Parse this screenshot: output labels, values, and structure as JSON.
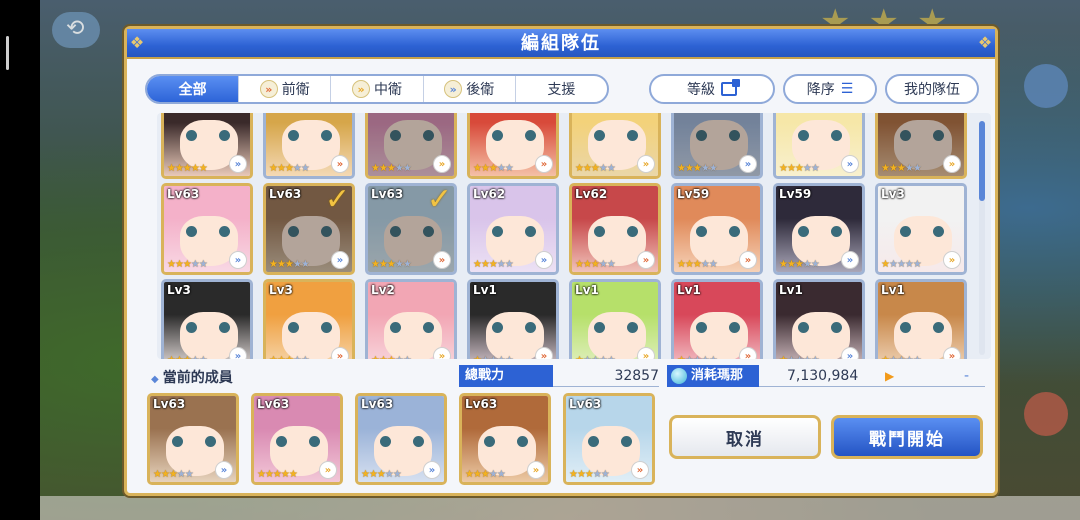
{
  "dialog": {
    "title": "編組隊伍"
  },
  "filter": {
    "tabs": [
      {
        "label": "全部",
        "icon": null,
        "active": true
      },
      {
        "label": "前衛",
        "icon": "front-role-icon",
        "active": false
      },
      {
        "label": "中衛",
        "icon": "mid-role-icon",
        "active": false
      },
      {
        "label": "後衛",
        "icon": "back-role-icon",
        "active": false
      },
      {
        "label": "支援",
        "icon": null,
        "active": false
      }
    ],
    "sort_label": "等級",
    "order_label": "降序",
    "my_team_label": "我的隊伍"
  },
  "roster": [
    {
      "lv": "",
      "stars": 5,
      "max_stars": 5,
      "role": "back",
      "selected": false,
      "hair": "#3a2a2a",
      "bg": "#e9c9b9",
      "rare": true
    },
    {
      "lv": "",
      "stars": 3,
      "max_stars": 5,
      "role": "front",
      "selected": false,
      "hair": "#d6a64a",
      "bg": "#f4d9b5",
      "rare": false
    },
    {
      "lv": "",
      "stars": 3,
      "max_stars": 5,
      "role": "mid",
      "selected": true,
      "hair": "#d98ab2",
      "bg": "#f2c7d7",
      "rare": true
    },
    {
      "lv": "",
      "stars": 3,
      "max_stars": 5,
      "role": "front",
      "selected": false,
      "hair": "#d84a3a",
      "bg": "#f4c0a6",
      "rare": true
    },
    {
      "lv": "",
      "stars": 3,
      "max_stars": 5,
      "role": "mid",
      "selected": false,
      "hair": "#f3d27a",
      "bg": "#ead6a8",
      "rare": true
    },
    {
      "lv": "",
      "stars": 3,
      "max_stars": 5,
      "role": "back",
      "selected": true,
      "hair": "#9bb3d8",
      "bg": "#c9d6ea",
      "rare": false
    },
    {
      "lv": "",
      "stars": 3,
      "max_stars": 5,
      "role": "back",
      "selected": false,
      "hair": "#f6e7a8",
      "bg": "#f8f0cf",
      "rare": false
    },
    {
      "lv": "",
      "stars": 3,
      "max_stars": 5,
      "role": "mid",
      "selected": true,
      "hair": "#b06a3a",
      "bg": "#e9c29a",
      "rare": true
    },
    {
      "lv": "Lv63",
      "stars": 3,
      "max_stars": 5,
      "role": "back",
      "selected": false,
      "hair": "#f4b1c9",
      "bg": "#f8d8e4",
      "rare": true
    },
    {
      "lv": "Lv63",
      "stars": 3,
      "max_stars": 5,
      "role": "back",
      "selected": true,
      "hair": "#9a7250",
      "bg": "#d7c2a8",
      "rare": true
    },
    {
      "lv": "Lv63",
      "stars": 3,
      "max_stars": 5,
      "role": "front",
      "selected": true,
      "hair": "#b7d6ea",
      "bg": "#d9e9f2",
      "rare": false
    },
    {
      "lv": "Lv62",
      "stars": 3,
      "max_stars": 5,
      "role": "back",
      "selected": false,
      "hair": "#d9c4ea",
      "bg": "#ece1f4",
      "rare": false
    },
    {
      "lv": "Lv62",
      "stars": 3,
      "max_stars": 5,
      "role": "front",
      "selected": false,
      "hair": "#c7484a",
      "bg": "#f0c2b9",
      "rare": true
    },
    {
      "lv": "Lv59",
      "stars": 3,
      "max_stars": 5,
      "role": "front",
      "selected": false,
      "hair": "#e08a5a",
      "bg": "#f6d2b8",
      "rare": false
    },
    {
      "lv": "Lv59",
      "stars": 3,
      "max_stars": 5,
      "role": "back",
      "selected": false,
      "hair": "#2e2a3a",
      "bg": "#a9a6b8",
      "rare": false
    },
    {
      "lv": "Lv3",
      "stars": 1,
      "max_stars": 5,
      "role": "mid",
      "selected": false,
      "hair": "#f2f2f2",
      "bg": "#f6e9ea",
      "rare": false
    },
    {
      "lv": "Lv3",
      "stars": 3,
      "max_stars": 5,
      "role": "back",
      "selected": false,
      "hair": "#2a2a2a",
      "bg": "#e6dedc",
      "rare": false
    },
    {
      "lv": "Lv3",
      "stars": 3,
      "max_stars": 5,
      "role": "front",
      "selected": false,
      "hair": "#f0a040",
      "bg": "#f6d8b0",
      "rare": true
    },
    {
      "lv": "Lv2",
      "stars": 3,
      "max_stars": 5,
      "role": "mid",
      "selected": false,
      "hair": "#f2a6b4",
      "bg": "#f8d8de",
      "rare": false
    },
    {
      "lv": "Lv1",
      "stars": 1,
      "max_stars": 5,
      "role": "front",
      "selected": false,
      "hair": "#2a2a2a",
      "bg": "#d8c8d0",
      "rare": false
    },
    {
      "lv": "Lv1",
      "stars": 1,
      "max_stars": 5,
      "role": "mid",
      "selected": false,
      "hair": "#b6e06a",
      "bg": "#e2f0c2",
      "rare": false
    },
    {
      "lv": "Lv1",
      "stars": 1,
      "max_stars": 5,
      "role": "front",
      "selected": false,
      "hair": "#d8485a",
      "bg": "#f4c6cc",
      "rare": false
    },
    {
      "lv": "Lv1",
      "stars": 1,
      "max_stars": 5,
      "role": "back",
      "selected": false,
      "hair": "#3a2a30",
      "bg": "#d6c2c6",
      "rare": false
    },
    {
      "lv": "Lv1",
      "stars": 1,
      "max_stars": 5,
      "role": "front",
      "selected": false,
      "hair": "#c8884a",
      "bg": "#f0d4b8",
      "rare": false
    }
  ],
  "current_members": {
    "label": "當前的成員",
    "members": [
      {
        "lv": "Lv63",
        "stars": 3,
        "max_stars": 5,
        "role": "back",
        "hair": "#9a7250",
        "bg": "#e6d2bc"
      },
      {
        "lv": "Lv63",
        "stars": 5,
        "max_stars": 5,
        "role": "mid",
        "hair": "#d98ab2",
        "bg": "#f2c7d7"
      },
      {
        "lv": "Lv63",
        "stars": 3,
        "max_stars": 5,
        "role": "back",
        "hair": "#9bb3d8",
        "bg": "#d6e0f0"
      },
      {
        "lv": "Lv63",
        "stars": 3,
        "max_stars": 5,
        "role": "mid",
        "hair": "#b06a3a",
        "bg": "#ecc9a4"
      },
      {
        "lv": "Lv63",
        "stars": 3,
        "max_stars": 5,
        "role": "front",
        "hair": "#b7d6ea",
        "bg": "#e0eef6"
      }
    ]
  },
  "stats": {
    "power_label": "總戰力",
    "power_value": "32857",
    "mana_label": "消耗瑪那",
    "mana_value": "7,130,984",
    "mana_arrow": "▶",
    "mana_result": "-"
  },
  "buttons": {
    "cancel": "取消",
    "start": "戰鬥開始"
  },
  "colors": {
    "accent_blue": "#2d62d4",
    "gold_border": "#d9b35a",
    "star_gold": "#f3b21f"
  }
}
